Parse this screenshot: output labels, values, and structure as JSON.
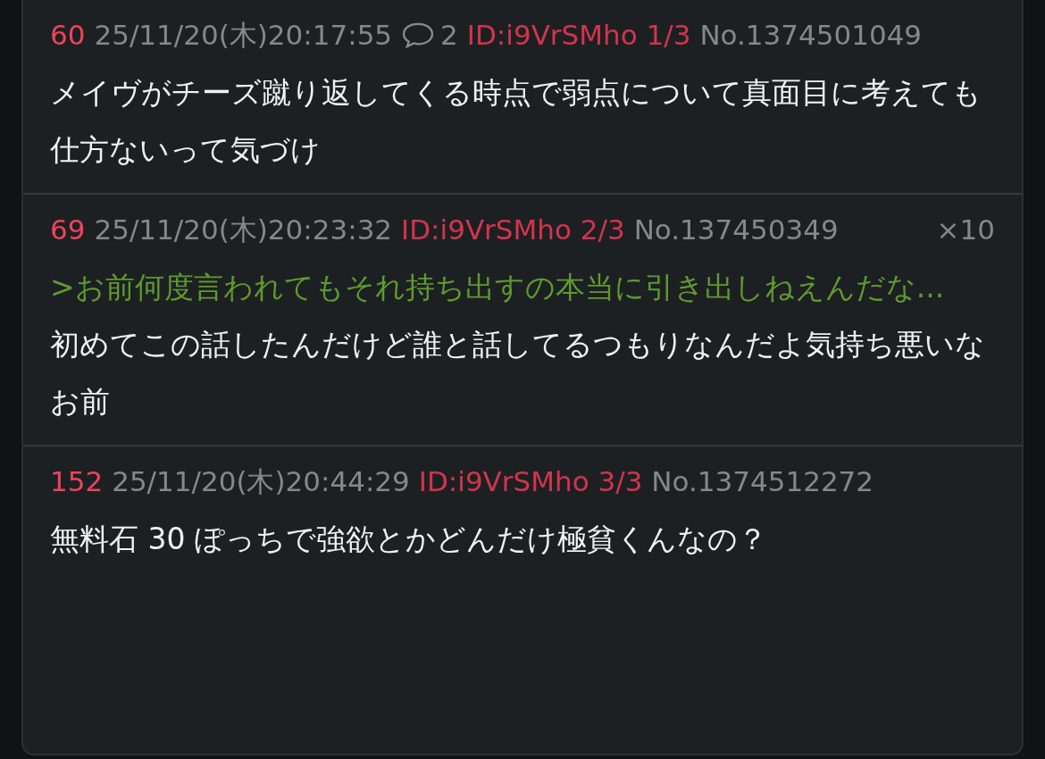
{
  "posts": [
    {
      "number": "60",
      "date": "25/11/20(木)20:17:55",
      "replies": "2",
      "id": "ID:i9VrSMho 1/3",
      "no": "No.1374501049",
      "lines": [
        {
          "kind": "text",
          "text": "メイヴがチーズ蹴り返してくる時点で弱点について真面目に考えても仕方ないって気づけ"
        }
      ]
    },
    {
      "number": "69",
      "date": "25/11/20(木)20:23:32",
      "id": "ID:i9VrSMho 2/3",
      "no": "No.137450349",
      "overlay": "×10",
      "lines": [
        {
          "kind": "quote",
          "text": ">お前何度言われてもそれ持ち出すの本当に引き出しねえんだな..."
        },
        {
          "kind": "text",
          "text": "初めてこの話したんだけど誰と話してるつもりなんだよ気持ち悪いなお前"
        }
      ]
    },
    {
      "number": "152",
      "date": "25/11/20(木)20:44:29",
      "id": "ID:i9VrSMho 3/3",
      "no": "No.1374512272",
      "lines": [
        {
          "kind": "text",
          "text": "無料石 30 ぽっちで強欲とかどんだけ極貧くんなの？"
        }
      ]
    }
  ]
}
